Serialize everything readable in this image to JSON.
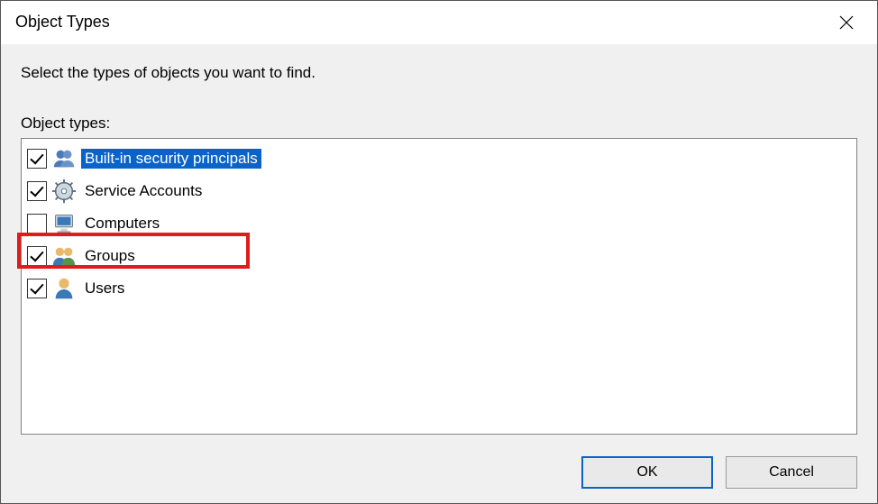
{
  "title": "Object Types",
  "instruction": "Select the types of objects you want to find.",
  "list_label": "Object types:",
  "items": [
    {
      "label": "Built-in security principals",
      "checked": true,
      "selected": true,
      "icon": "principals"
    },
    {
      "label": "Service Accounts",
      "checked": true,
      "selected": false,
      "icon": "gear",
      "highlighted": true
    },
    {
      "label": "Computers",
      "checked": false,
      "selected": false,
      "icon": "computer"
    },
    {
      "label": "Groups",
      "checked": true,
      "selected": false,
      "icon": "group"
    },
    {
      "label": "Users",
      "checked": true,
      "selected": false,
      "icon": "user"
    }
  ],
  "buttons": {
    "ok": "OK",
    "cancel": "Cancel"
  }
}
